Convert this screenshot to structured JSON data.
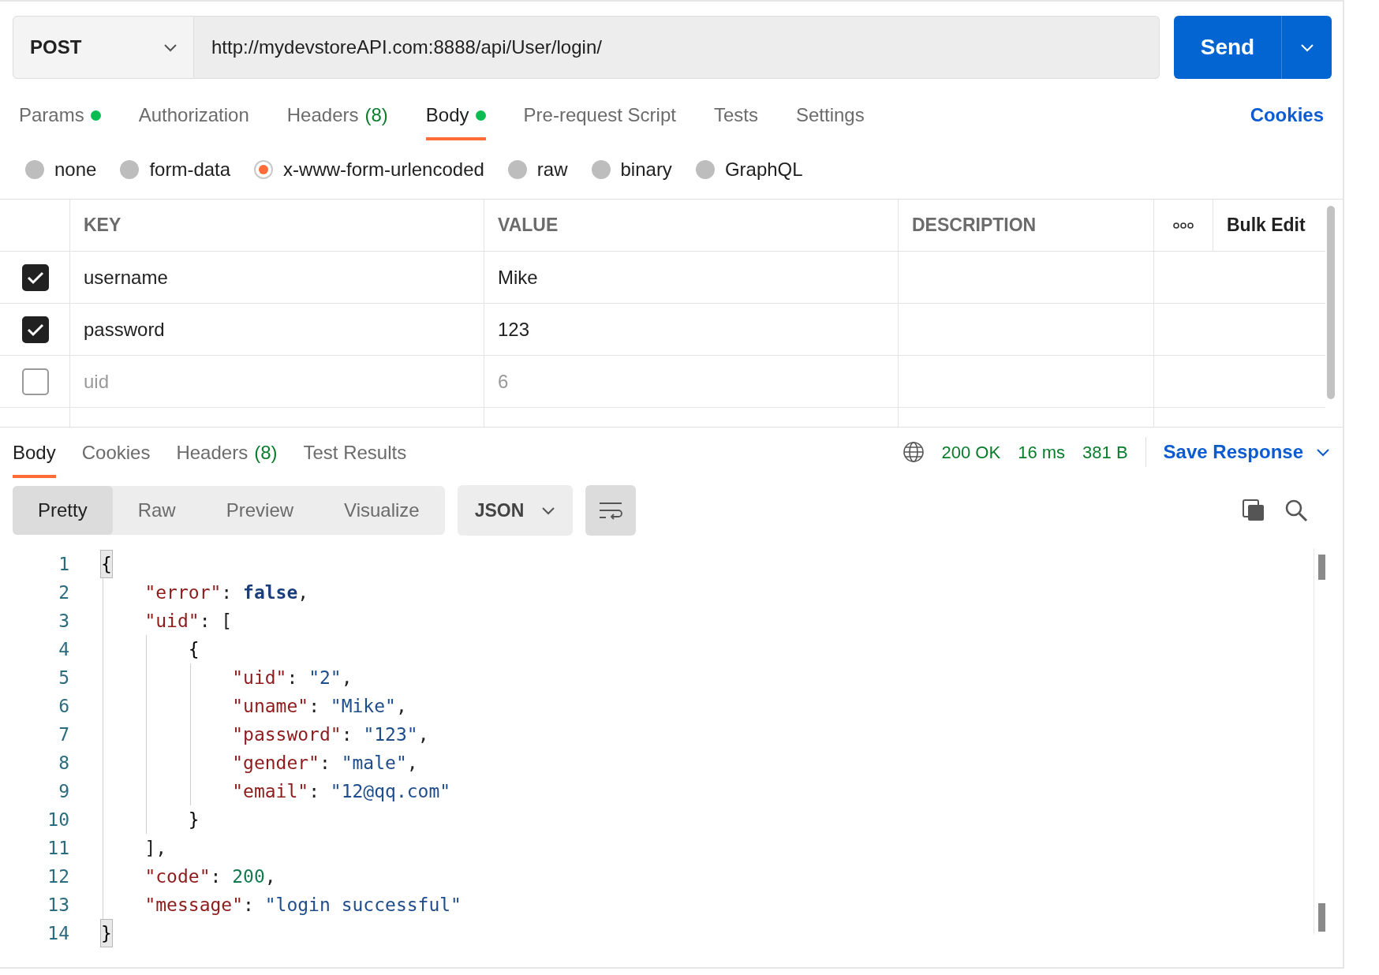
{
  "request": {
    "method": "POST",
    "url": "http://mydevstoreAPI.com:8888/api/User/login/",
    "send": "Send"
  },
  "request_tabs": [
    {
      "label": "Params",
      "dot": true,
      "selected": false
    },
    {
      "label": "Authorization",
      "dot": false,
      "selected": false
    },
    {
      "label": "Headers",
      "count": "(8)",
      "dot": false,
      "selected": false
    },
    {
      "label": "Body",
      "dot": true,
      "selected": true
    },
    {
      "label": "Pre-request Script",
      "dot": false,
      "selected": false
    },
    {
      "label": "Tests",
      "dot": false,
      "selected": false
    },
    {
      "label": "Settings",
      "dot": false,
      "selected": false
    }
  ],
  "cookies_link": "Cookies",
  "body_types": [
    {
      "label": "none",
      "selected": false
    },
    {
      "label": "form-data",
      "selected": false
    },
    {
      "label": "x-www-form-urlencoded",
      "selected": true
    },
    {
      "label": "raw",
      "selected": false
    },
    {
      "label": "binary",
      "selected": false
    },
    {
      "label": "GraphQL",
      "selected": false
    }
  ],
  "params_table": {
    "columns": [
      "KEY",
      "VALUE",
      "DESCRIPTION"
    ],
    "bulk_edit": "Bulk Edit",
    "rows": [
      {
        "checked": true,
        "key": "username",
        "value": "Mike"
      },
      {
        "checked": true,
        "key": "password",
        "value": "123"
      },
      {
        "checked": false,
        "key": "uid",
        "value": "6"
      }
    ]
  },
  "response_tabs": [
    {
      "label": "Body",
      "selected": true
    },
    {
      "label": "Cookies",
      "selected": false
    },
    {
      "label": "Headers",
      "count": "(8)",
      "selected": false
    },
    {
      "label": "Test Results",
      "selected": false
    }
  ],
  "response_status": {
    "status": "200 OK",
    "time": "16 ms",
    "size": "381 B",
    "save": "Save Response"
  },
  "view_modes": [
    {
      "label": "Pretty",
      "selected": true
    },
    {
      "label": "Raw",
      "selected": false
    },
    {
      "label": "Preview",
      "selected": false
    },
    {
      "label": "Visualize",
      "selected": false
    }
  ],
  "format": "JSON",
  "code_lines": [
    {
      "number": "1",
      "tokens": [
        {
          "t": "{",
          "kind": "brace",
          "matched": true
        }
      ],
      "children": [
        {
          "number": "2",
          "tokens": [
            {
              "t": "\"error\"",
              "kind": "key"
            },
            {
              "t": ": ",
              "kind": "punct"
            },
            {
              "t": "false",
              "kind": "bool"
            },
            {
              "t": ",",
              "kind": "punct"
            }
          ]
        },
        {
          "number": "3",
          "tokens": [
            {
              "t": "\"uid\"",
              "kind": "key"
            },
            {
              "t": ": [",
              "kind": "punct"
            }
          ],
          "children": [
            {
              "number": "4",
              "tokens": [
                {
                  "t": "{",
                  "kind": "brace",
                  "matched": false
                }
              ],
              "children": [
                {
                  "number": "5",
                  "tokens": [
                    {
                      "t": "\"uid\"",
                      "kind": "key"
                    },
                    {
                      "t": ": ",
                      "kind": "punct"
                    },
                    {
                      "t": "\"2\"",
                      "kind": "string"
                    },
                    {
                      "t": ",",
                      "kind": "punct"
                    }
                  ]
                },
                {
                  "number": "6",
                  "tokens": [
                    {
                      "t": "\"uname\"",
                      "kind": "key"
                    },
                    {
                      "t": ": ",
                      "kind": "punct"
                    },
                    {
                      "t": "\"Mike\"",
                      "kind": "string"
                    },
                    {
                      "t": ",",
                      "kind": "punct"
                    }
                  ]
                },
                {
                  "number": "7",
                  "tokens": [
                    {
                      "t": "\"password\"",
                      "kind": "key"
                    },
                    {
                      "t": ": ",
                      "kind": "punct"
                    },
                    {
                      "t": "\"123\"",
                      "kind": "string"
                    },
                    {
                      "t": ",",
                      "kind": "punct"
                    }
                  ]
                },
                {
                  "number": "8",
                  "tokens": [
                    {
                      "t": "\"gender\"",
                      "kind": "key"
                    },
                    {
                      "t": ": ",
                      "kind": "punct"
                    },
                    {
                      "t": "\"male\"",
                      "kind": "string"
                    },
                    {
                      "t": ",",
                      "kind": "punct"
                    }
                  ]
                },
                {
                  "number": "9",
                  "tokens": [
                    {
                      "t": "\"email\"",
                      "kind": "key"
                    },
                    {
                      "t": ": ",
                      "kind": "punct"
                    },
                    {
                      "t": "\"12@qq.com\"",
                      "kind": "string"
                    }
                  ]
                }
              ]
            },
            {
              "number": "10",
              "tokens": [
                {
                  "t": "}",
                  "kind": "brace",
                  "matched": false
                }
              ]
            }
          ]
        },
        {
          "number": "11",
          "tokens": [
            {
              "t": "],",
              "kind": "punct"
            }
          ]
        },
        {
          "number": "12",
          "tokens": [
            {
              "t": "\"code\"",
              "kind": "key"
            },
            {
              "t": ": ",
              "kind": "punct"
            },
            {
              "t": "200",
              "kind": "number"
            },
            {
              "t": ",",
              "kind": "punct"
            }
          ]
        },
        {
          "number": "13",
          "tokens": [
            {
              "t": "\"message\"",
              "kind": "key"
            },
            {
              "t": ": ",
              "kind": "punct"
            },
            {
              "t": "\"login successful\"",
              "kind": "string"
            }
          ]
        }
      ]
    },
    {
      "number": "14",
      "tokens": [
        {
          "t": "}",
          "kind": "brace",
          "matched": true
        }
      ]
    }
  ]
}
